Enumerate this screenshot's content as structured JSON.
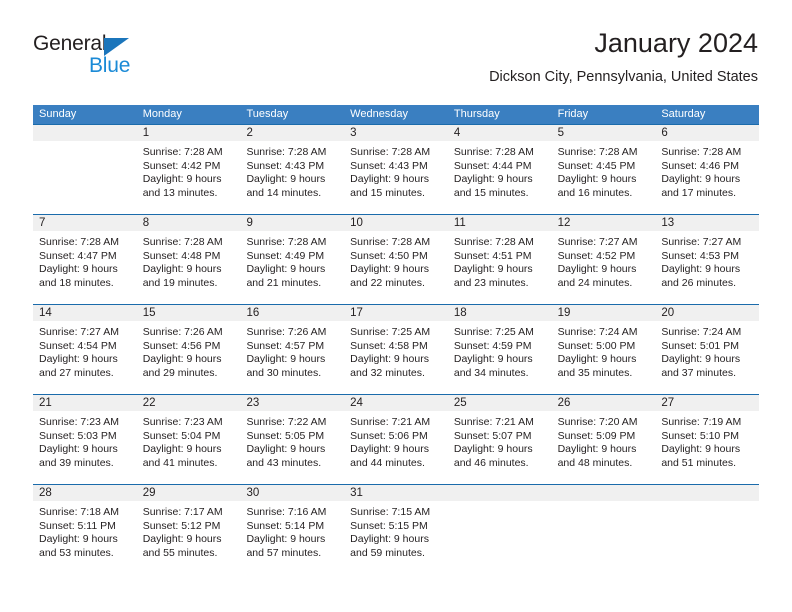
{
  "brand": {
    "name_part1": "General",
    "name_part2": "Blue",
    "triangle_color": "#1b75bb",
    "blue_text_color": "#1b8ad6"
  },
  "header": {
    "title": "January 2024",
    "subtitle": "Dickson City, Pennsylvania, United States"
  },
  "theme": {
    "header_row_bg": "#3a7fc1",
    "week_divider": "#1b6bab",
    "daynum_band_bg": "#f0f0f0",
    "text": "#231f20"
  },
  "weekdays": [
    "Sunday",
    "Monday",
    "Tuesday",
    "Wednesday",
    "Thursday",
    "Friday",
    "Saturday"
  ],
  "weeks": [
    {
      "days": [
        {
          "num": "",
          "sunrise": "",
          "sunset": "",
          "daylight1": "",
          "daylight2": ""
        },
        {
          "num": "1",
          "sunrise": "Sunrise: 7:28 AM",
          "sunset": "Sunset: 4:42 PM",
          "daylight1": "Daylight: 9 hours",
          "daylight2": "and 13 minutes."
        },
        {
          "num": "2",
          "sunrise": "Sunrise: 7:28 AM",
          "sunset": "Sunset: 4:43 PM",
          "daylight1": "Daylight: 9 hours",
          "daylight2": "and 14 minutes."
        },
        {
          "num": "3",
          "sunrise": "Sunrise: 7:28 AM",
          "sunset": "Sunset: 4:43 PM",
          "daylight1": "Daylight: 9 hours",
          "daylight2": "and 15 minutes."
        },
        {
          "num": "4",
          "sunrise": "Sunrise: 7:28 AM",
          "sunset": "Sunset: 4:44 PM",
          "daylight1": "Daylight: 9 hours",
          "daylight2": "and 15 minutes."
        },
        {
          "num": "5",
          "sunrise": "Sunrise: 7:28 AM",
          "sunset": "Sunset: 4:45 PM",
          "daylight1": "Daylight: 9 hours",
          "daylight2": "and 16 minutes."
        },
        {
          "num": "6",
          "sunrise": "Sunrise: 7:28 AM",
          "sunset": "Sunset: 4:46 PM",
          "daylight1": "Daylight: 9 hours",
          "daylight2": "and 17 minutes."
        }
      ]
    },
    {
      "days": [
        {
          "num": "7",
          "sunrise": "Sunrise: 7:28 AM",
          "sunset": "Sunset: 4:47 PM",
          "daylight1": "Daylight: 9 hours",
          "daylight2": "and 18 minutes."
        },
        {
          "num": "8",
          "sunrise": "Sunrise: 7:28 AM",
          "sunset": "Sunset: 4:48 PM",
          "daylight1": "Daylight: 9 hours",
          "daylight2": "and 19 minutes."
        },
        {
          "num": "9",
          "sunrise": "Sunrise: 7:28 AM",
          "sunset": "Sunset: 4:49 PM",
          "daylight1": "Daylight: 9 hours",
          "daylight2": "and 21 minutes."
        },
        {
          "num": "10",
          "sunrise": "Sunrise: 7:28 AM",
          "sunset": "Sunset: 4:50 PM",
          "daylight1": "Daylight: 9 hours",
          "daylight2": "and 22 minutes."
        },
        {
          "num": "11",
          "sunrise": "Sunrise: 7:28 AM",
          "sunset": "Sunset: 4:51 PM",
          "daylight1": "Daylight: 9 hours",
          "daylight2": "and 23 minutes."
        },
        {
          "num": "12",
          "sunrise": "Sunrise: 7:27 AM",
          "sunset": "Sunset: 4:52 PM",
          "daylight1": "Daylight: 9 hours",
          "daylight2": "and 24 minutes."
        },
        {
          "num": "13",
          "sunrise": "Sunrise: 7:27 AM",
          "sunset": "Sunset: 4:53 PM",
          "daylight1": "Daylight: 9 hours",
          "daylight2": "and 26 minutes."
        }
      ]
    },
    {
      "days": [
        {
          "num": "14",
          "sunrise": "Sunrise: 7:27 AM",
          "sunset": "Sunset: 4:54 PM",
          "daylight1": "Daylight: 9 hours",
          "daylight2": "and 27 minutes."
        },
        {
          "num": "15",
          "sunrise": "Sunrise: 7:26 AM",
          "sunset": "Sunset: 4:56 PM",
          "daylight1": "Daylight: 9 hours",
          "daylight2": "and 29 minutes."
        },
        {
          "num": "16",
          "sunrise": "Sunrise: 7:26 AM",
          "sunset": "Sunset: 4:57 PM",
          "daylight1": "Daylight: 9 hours",
          "daylight2": "and 30 minutes."
        },
        {
          "num": "17",
          "sunrise": "Sunrise: 7:25 AM",
          "sunset": "Sunset: 4:58 PM",
          "daylight1": "Daylight: 9 hours",
          "daylight2": "and 32 minutes."
        },
        {
          "num": "18",
          "sunrise": "Sunrise: 7:25 AM",
          "sunset": "Sunset: 4:59 PM",
          "daylight1": "Daylight: 9 hours",
          "daylight2": "and 34 minutes."
        },
        {
          "num": "19",
          "sunrise": "Sunrise: 7:24 AM",
          "sunset": "Sunset: 5:00 PM",
          "daylight1": "Daylight: 9 hours",
          "daylight2": "and 35 minutes."
        },
        {
          "num": "20",
          "sunrise": "Sunrise: 7:24 AM",
          "sunset": "Sunset: 5:01 PM",
          "daylight1": "Daylight: 9 hours",
          "daylight2": "and 37 minutes."
        }
      ]
    },
    {
      "days": [
        {
          "num": "21",
          "sunrise": "Sunrise: 7:23 AM",
          "sunset": "Sunset: 5:03 PM",
          "daylight1": "Daylight: 9 hours",
          "daylight2": "and 39 minutes."
        },
        {
          "num": "22",
          "sunrise": "Sunrise: 7:23 AM",
          "sunset": "Sunset: 5:04 PM",
          "daylight1": "Daylight: 9 hours",
          "daylight2": "and 41 minutes."
        },
        {
          "num": "23",
          "sunrise": "Sunrise: 7:22 AM",
          "sunset": "Sunset: 5:05 PM",
          "daylight1": "Daylight: 9 hours",
          "daylight2": "and 43 minutes."
        },
        {
          "num": "24",
          "sunrise": "Sunrise: 7:21 AM",
          "sunset": "Sunset: 5:06 PM",
          "daylight1": "Daylight: 9 hours",
          "daylight2": "and 44 minutes."
        },
        {
          "num": "25",
          "sunrise": "Sunrise: 7:21 AM",
          "sunset": "Sunset: 5:07 PM",
          "daylight1": "Daylight: 9 hours",
          "daylight2": "and 46 minutes."
        },
        {
          "num": "26",
          "sunrise": "Sunrise: 7:20 AM",
          "sunset": "Sunset: 5:09 PM",
          "daylight1": "Daylight: 9 hours",
          "daylight2": "and 48 minutes."
        },
        {
          "num": "27",
          "sunrise": "Sunrise: 7:19 AM",
          "sunset": "Sunset: 5:10 PM",
          "daylight1": "Daylight: 9 hours",
          "daylight2": "and 51 minutes."
        }
      ]
    },
    {
      "days": [
        {
          "num": "28",
          "sunrise": "Sunrise: 7:18 AM",
          "sunset": "Sunset: 5:11 PM",
          "daylight1": "Daylight: 9 hours",
          "daylight2": "and 53 minutes."
        },
        {
          "num": "29",
          "sunrise": "Sunrise: 7:17 AM",
          "sunset": "Sunset: 5:12 PM",
          "daylight1": "Daylight: 9 hours",
          "daylight2": "and 55 minutes."
        },
        {
          "num": "30",
          "sunrise": "Sunrise: 7:16 AM",
          "sunset": "Sunset: 5:14 PM",
          "daylight1": "Daylight: 9 hours",
          "daylight2": "and 57 minutes."
        },
        {
          "num": "31",
          "sunrise": "Sunrise: 7:15 AM",
          "sunset": "Sunset: 5:15 PM",
          "daylight1": "Daylight: 9 hours",
          "daylight2": "and 59 minutes."
        },
        {
          "num": "",
          "sunrise": "",
          "sunset": "",
          "daylight1": "",
          "daylight2": ""
        },
        {
          "num": "",
          "sunrise": "",
          "sunset": "",
          "daylight1": "",
          "daylight2": ""
        },
        {
          "num": "",
          "sunrise": "",
          "sunset": "",
          "daylight1": "",
          "daylight2": ""
        }
      ]
    }
  ]
}
